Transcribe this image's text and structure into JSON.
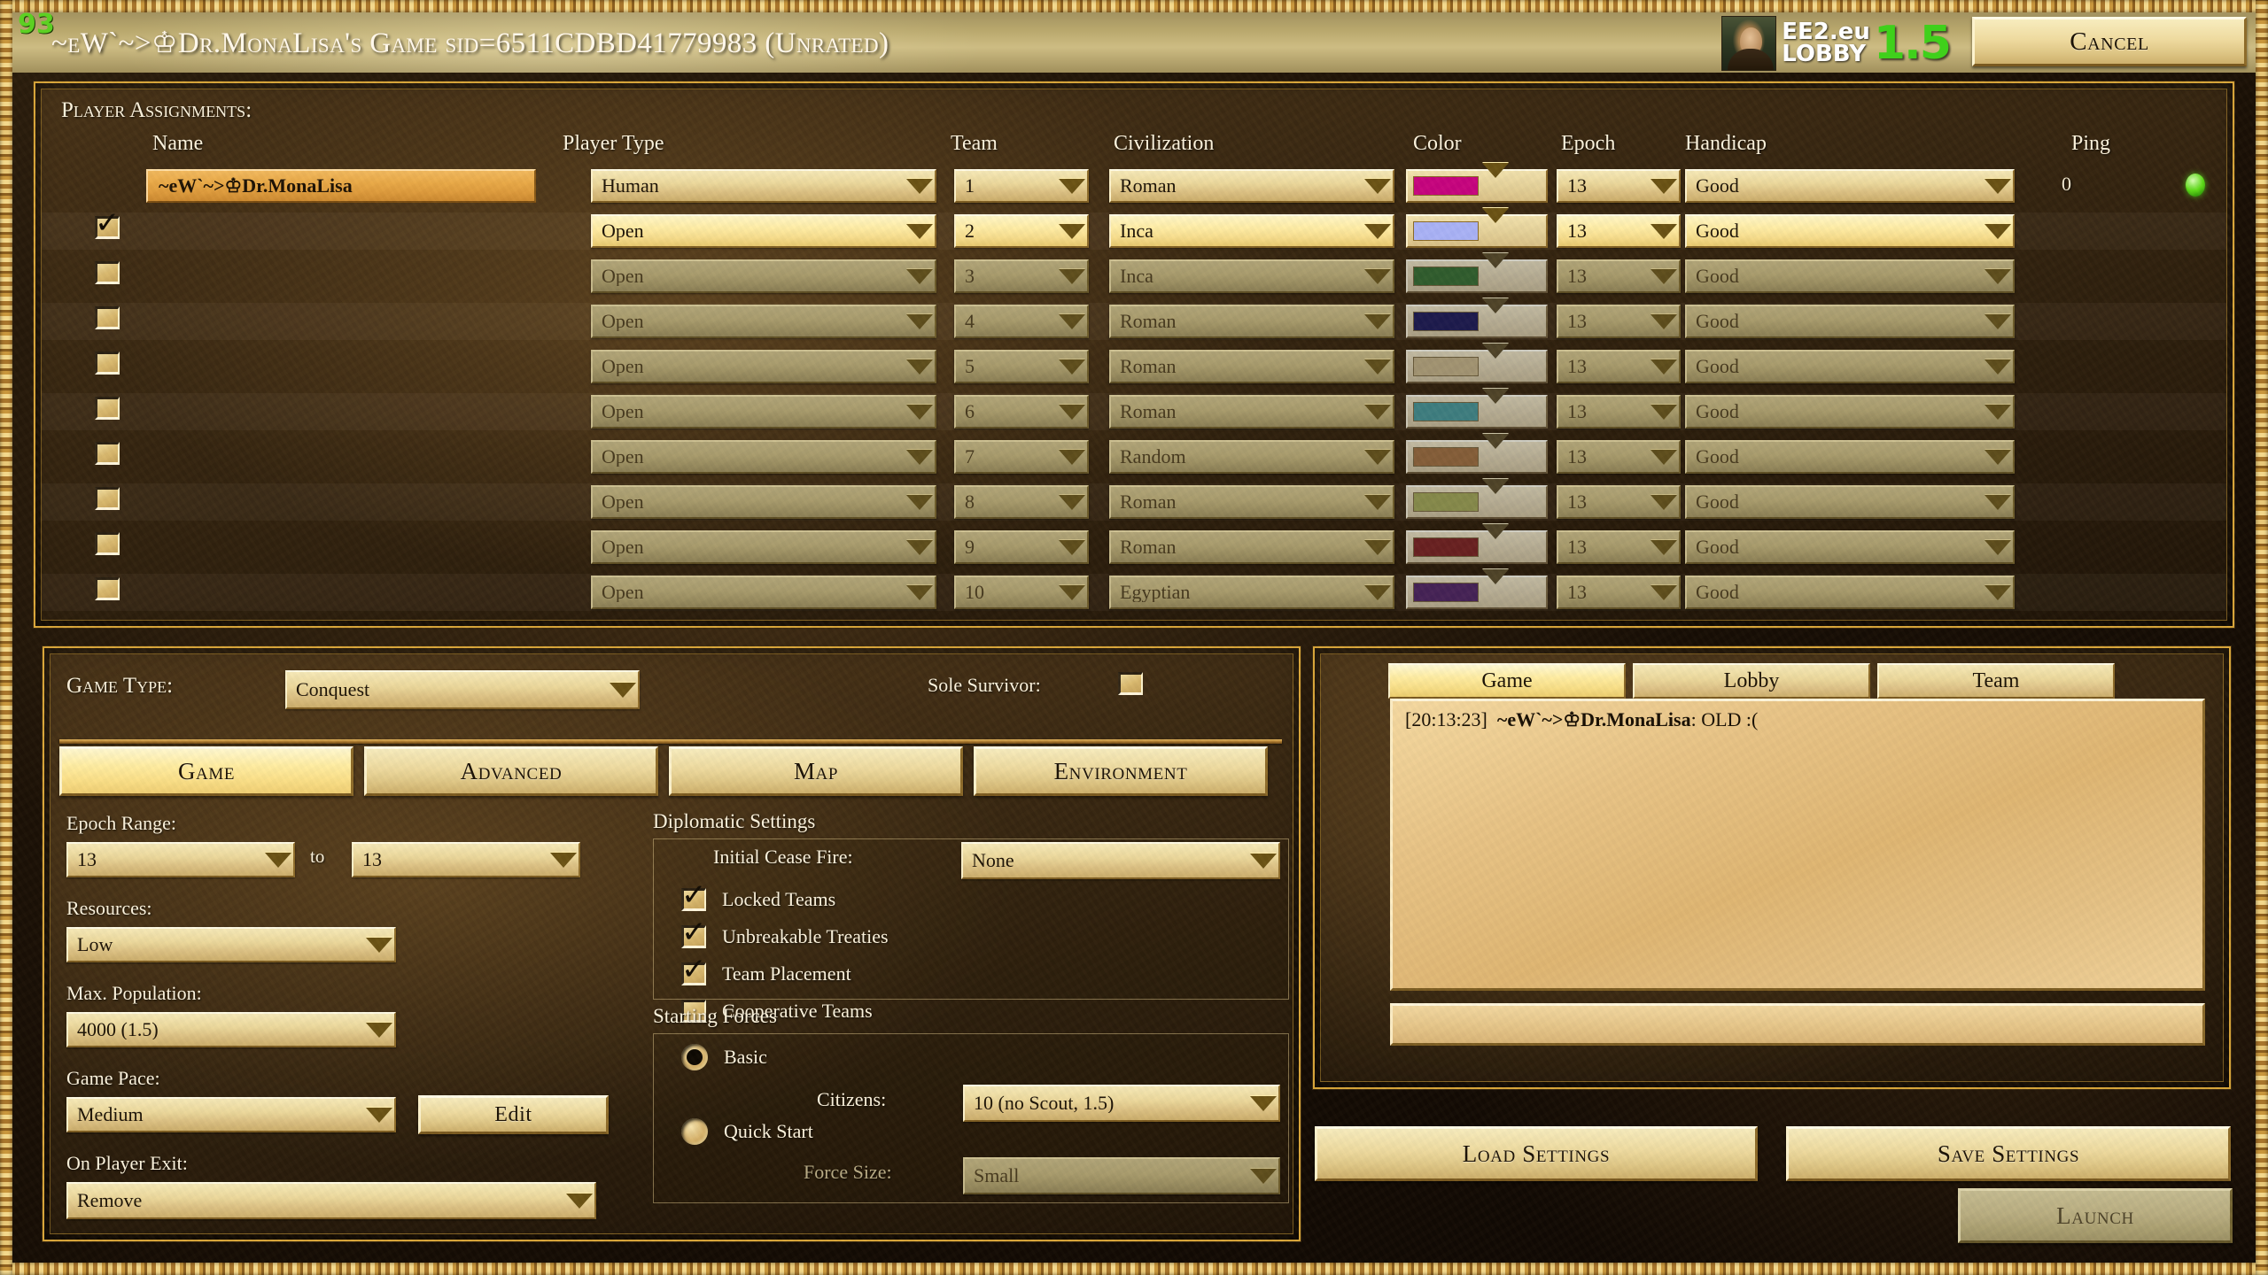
{
  "header": {
    "queue_count": "93",
    "game_title": "~eW`~>♔Dr.MonaLisa's Game sid=6511CDBD41779983 (Unrated)",
    "logo_line1": "EE2.eu",
    "logo_line2": "LOBBY",
    "logo_version": "1.5",
    "cancel_label": "Cancel"
  },
  "players": {
    "section_title": "Player Assignments:",
    "columns": {
      "name": "Name",
      "player_type": "Player Type",
      "team": "Team",
      "civilization": "Civilization",
      "color": "Color",
      "epoch": "Epoch",
      "handicap": "Handicap",
      "ping": "Ping"
    },
    "rows": [
      {
        "checked": false,
        "show_checkbox": false,
        "name": "~eW`~>♔Dr.MonaLisa",
        "type": "Human",
        "team": "1",
        "civ": "Roman",
        "color": "#c6047f",
        "epoch": "13",
        "handicap": "Good",
        "ping": "0",
        "ping_light": true,
        "state": "active"
      },
      {
        "checked": true,
        "show_checkbox": true,
        "name": "",
        "type": "Open",
        "team": "2",
        "civ": "Inca",
        "color": "#a9b2f7",
        "epoch": "13",
        "handicap": "Good",
        "ping": "",
        "ping_light": false,
        "state": "hot"
      },
      {
        "checked": false,
        "show_checkbox": true,
        "name": "",
        "type": "Open",
        "team": "3",
        "civ": "Inca",
        "color": "#1b7d16",
        "epoch": "13",
        "handicap": "Good",
        "ping": "",
        "ping_light": false,
        "state": "dim"
      },
      {
        "checked": false,
        "show_checkbox": true,
        "name": "",
        "type": "Open",
        "team": "4",
        "civ": "Roman",
        "color": "#201b8e",
        "epoch": "13",
        "handicap": "Good",
        "ping": "",
        "ping_light": false,
        "state": "dim"
      },
      {
        "checked": false,
        "show_checkbox": true,
        "name": "",
        "type": "Open",
        "team": "5",
        "civ": "Roman",
        "color": "#d2b26a",
        "epoch": "13",
        "handicap": "Good",
        "ping": "",
        "ping_light": false,
        "state": "dim"
      },
      {
        "checked": false,
        "show_checkbox": true,
        "name": "",
        "type": "Open",
        "team": "6",
        "civ": "Roman",
        "color": "#1aa6ab",
        "epoch": "13",
        "handicap": "Good",
        "ping": "",
        "ping_light": false,
        "state": "dim"
      },
      {
        "checked": false,
        "show_checkbox": true,
        "name": "",
        "type": "Open",
        "team": "7",
        "civ": "Random",
        "color": "#c36b1c",
        "epoch": "13",
        "handicap": "Good",
        "ping": "",
        "ping_light": false,
        "state": "dim"
      },
      {
        "checked": false,
        "show_checkbox": true,
        "name": "",
        "type": "Open",
        "team": "8",
        "civ": "Roman",
        "color": "#a3ad22",
        "epoch": "13",
        "handicap": "Good",
        "ping": "",
        "ping_light": false,
        "state": "dim"
      },
      {
        "checked": false,
        "show_checkbox": true,
        "name": "",
        "type": "Open",
        "team": "9",
        "civ": "Roman",
        "color": "#b8171b",
        "epoch": "13",
        "handicap": "Good",
        "ping": "",
        "ping_light": false,
        "state": "dim"
      },
      {
        "checked": false,
        "show_checkbox": true,
        "name": "",
        "type": "Open",
        "team": "10",
        "civ": "Egyptian",
        "color": "#6b1f91",
        "epoch": "13",
        "handicap": "Good",
        "ping": "",
        "ping_light": false,
        "state": "dim"
      }
    ]
  },
  "settings": {
    "game_type_label": "Game Type:",
    "game_type_value": "Conquest",
    "sole_survivor_label": "Sole Survivor:",
    "sole_survivor_checked": false,
    "tabs": [
      {
        "label": "Game",
        "selected": true
      },
      {
        "label": "Advanced",
        "selected": false
      },
      {
        "label": "Map",
        "selected": false
      },
      {
        "label": "Environment",
        "selected": false
      }
    ],
    "epoch_range_label": "Epoch Range:",
    "epoch_from": "13",
    "epoch_to_word": "to",
    "epoch_to": "13",
    "resources_label": "Resources:",
    "resources_value": "Low",
    "max_population_label": "Max. Population:",
    "max_population_value": "4000 (1.5)",
    "game_pace_label": "Game Pace:",
    "game_pace_value": "Medium",
    "edit_label": "Edit",
    "on_player_exit_label": "On Player Exit:",
    "on_player_exit_value": "Remove",
    "diplomatic": {
      "title": "Diplomatic Settings",
      "cease_fire_label": "Initial Cease Fire:",
      "cease_fire_value": "None",
      "checks": [
        {
          "label": "Locked Teams",
          "checked": true
        },
        {
          "label": "Unbreakable Treaties",
          "checked": true
        },
        {
          "label": "Team Placement",
          "checked": true
        },
        {
          "label": "Cooperative Teams",
          "checked": false
        }
      ]
    },
    "starting_forces": {
      "title": "Starting Forces",
      "basic_label": "Basic",
      "basic_selected": true,
      "citizens_label": "Citizens:",
      "citizens_value": "10 (no Scout, 1.5)",
      "quick_start_label": "Quick Start",
      "quick_start_selected": false,
      "force_size_label": "Force Size:",
      "force_size_value": "Small"
    }
  },
  "chat": {
    "tabs": [
      {
        "label": "Game",
        "selected": true
      },
      {
        "label": "Lobby",
        "selected": false
      },
      {
        "label": "Team",
        "selected": false
      }
    ],
    "messages": [
      {
        "time": "[20:13:23]",
        "author": "~eW`~>♔Dr.MonaLisa",
        "text": ": OLD :("
      }
    ],
    "input_value": ""
  },
  "footer": {
    "load_settings_label": "Load Settings",
    "save_settings_label": "Save Settings",
    "launch_label": "Launch"
  }
}
